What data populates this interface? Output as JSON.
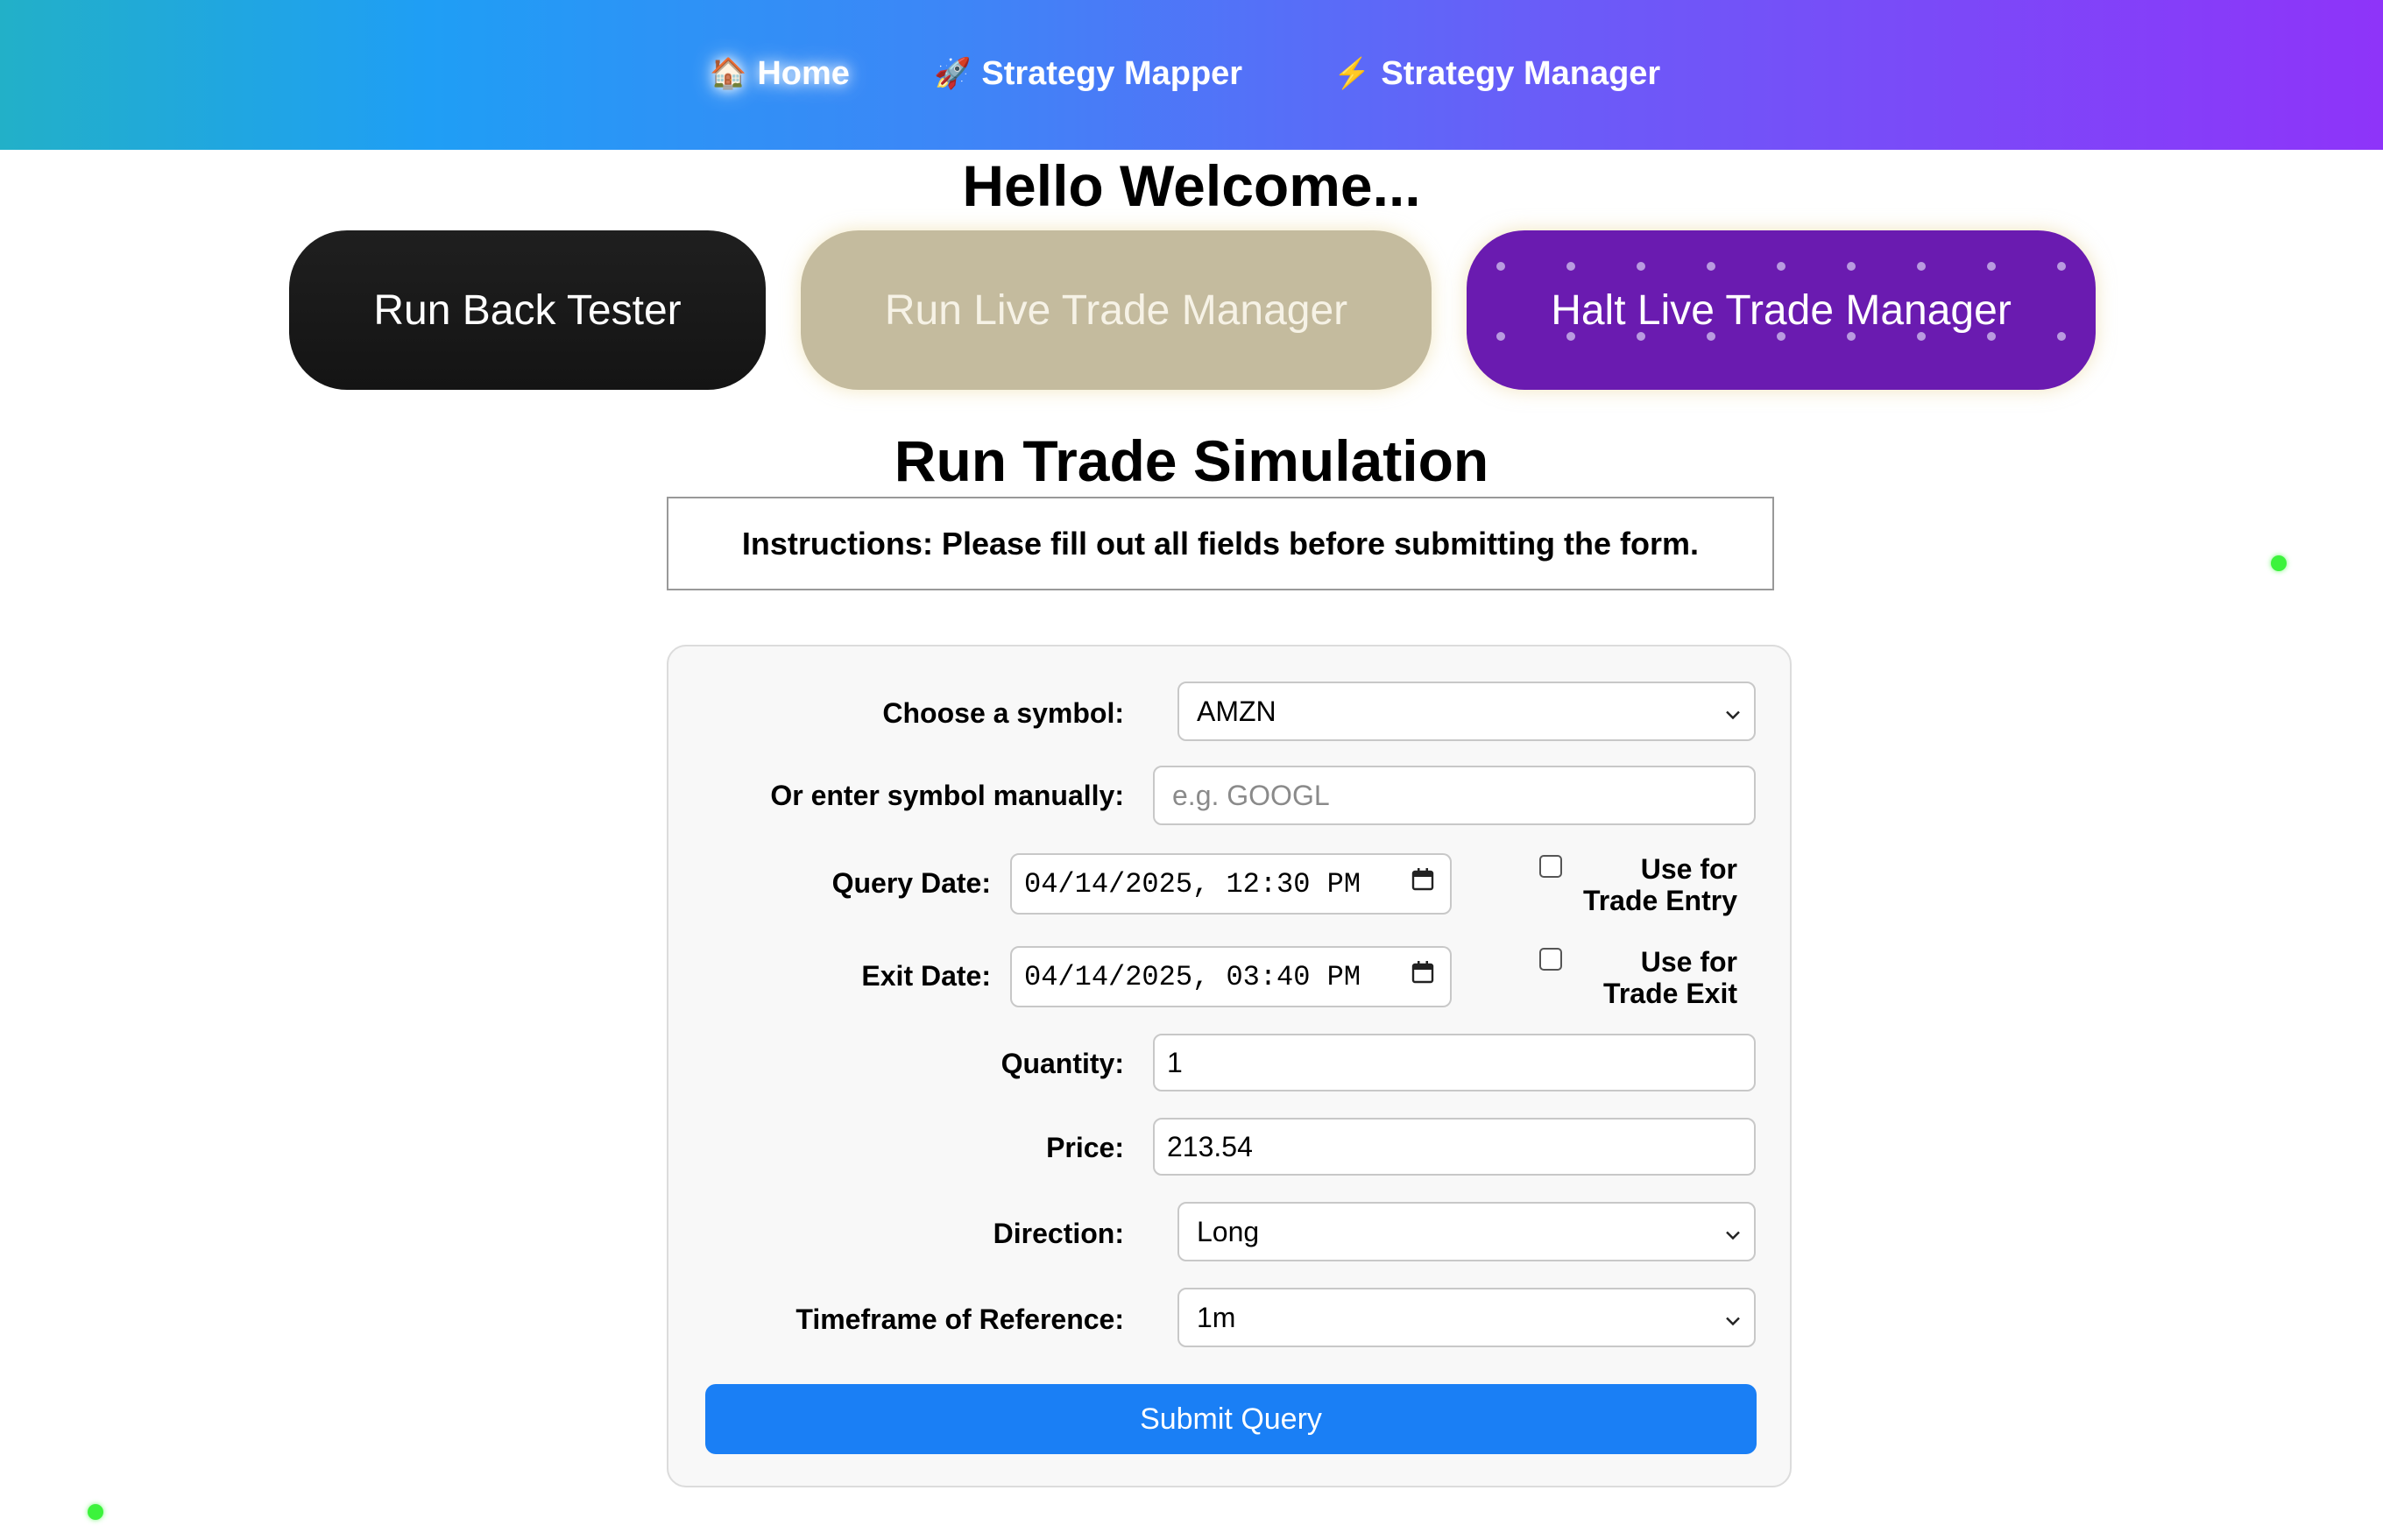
{
  "nav": {
    "items": [
      {
        "icon": "house-icon",
        "glyph": "🏠",
        "label": "Home",
        "active": true
      },
      {
        "icon": "rocket-icon",
        "glyph": "🚀",
        "label": "Strategy Mapper",
        "active": false
      },
      {
        "icon": "lightning-icon",
        "glyph": "⚡",
        "label": "Strategy Manager",
        "active": false
      }
    ]
  },
  "welcome": "Hello Welcome...",
  "actions": {
    "backtest_label": "Run Back Tester",
    "live_label": "Run Live Trade Manager",
    "halt_label": "Halt Live Trade Manager"
  },
  "simulation_title": "Run Trade Simulation",
  "instructions": "Instructions: Please fill out all fields before submitting the form.",
  "form": {
    "symbol_label": "Choose a symbol:",
    "symbol_value": "AMZN",
    "manual_label": "Or enter symbol manually:",
    "manual_placeholder": "e.g. GOOGL",
    "query_date_label": "Query Date:",
    "query_date_value": "04/14/2025, 12:30 PM",
    "use_entry_label_1": "Use for",
    "use_entry_label_2": "Trade Entry",
    "exit_date_label": "Exit Date:",
    "exit_date_value": "04/14/2025, 03:40 PM",
    "use_exit_label_1": "Use for",
    "use_exit_label_2": "Trade Exit",
    "quantity_label": "Quantity:",
    "quantity_value": "1",
    "price_label": "Price:",
    "price_value": "213.54",
    "direction_label": "Direction:",
    "direction_value": "Long",
    "timeframe_label": "Timeframe of Reference:",
    "timeframe_value": "1m",
    "submit_label": "Submit Query"
  },
  "colors": {
    "nav_gradient_start": "#22b0c8",
    "nav_gradient_end": "#8e34f9",
    "backtest_button": "#1f1f1f",
    "live_button": "#c4bb9e",
    "halt_button": "#6a1bb0",
    "submit_button": "#1a7ff5",
    "indicator_dot": "#3cf33c"
  }
}
